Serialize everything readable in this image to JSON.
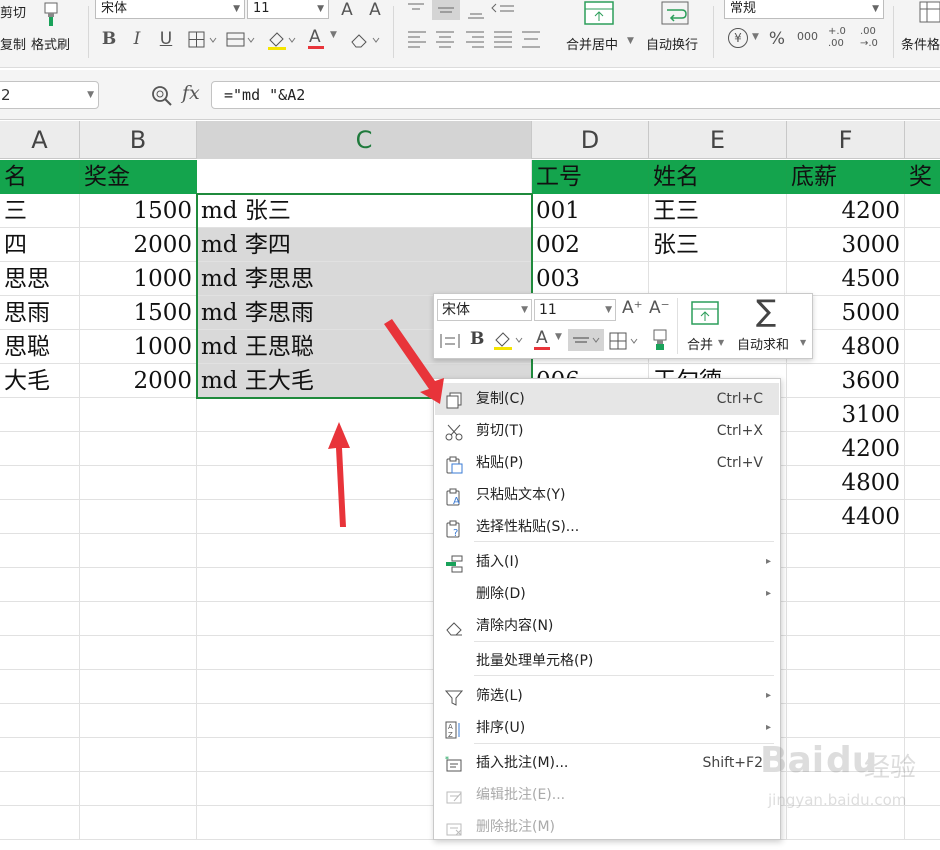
{
  "ribbon": {
    "cut_label": "剪切",
    "copy_label": "复制",
    "format_painter_label": "格式刷",
    "font_name": "宋体",
    "font_size": "11",
    "merge_center_label": "合并居中",
    "wrap_text_label": "自动换行",
    "number_format": "常规",
    "conditional_label": "条件格",
    "bold_glyph": "B",
    "italic_glyph": "I",
    "underline_glyph": "U",
    "font_color_glyph": "A",
    "currency_glyph": "¥",
    "percent_glyph": "%",
    "thousands_glyph": "000",
    "inc_decimal_glyph": "+.0 .00",
    "dec_decimal_glyph": ".00 →.0"
  },
  "formula_bar": {
    "name_box": "2",
    "fx_label": "fx",
    "formula": "=\"md \"&A2"
  },
  "columns": [
    "A",
    "B",
    "C",
    "D",
    "E",
    "F"
  ],
  "header_row": {
    "a": "名",
    "b": "奖金",
    "c": "",
    "d": "工号",
    "e": "姓名",
    "f": "底薪",
    "g": "奖"
  },
  "rows": [
    {
      "a": "三",
      "b": "1500",
      "c": "md 张三",
      "d": "001",
      "e": "王三",
      "f": "4200"
    },
    {
      "a": "四",
      "b": "2000",
      "c": "md 李四",
      "d": "002",
      "e": "张三",
      "f": "3000"
    },
    {
      "a": "思思",
      "b": "1000",
      "c": "md 李思思",
      "d": "003",
      "e": "",
      "f": "4500"
    },
    {
      "a": "思雨",
      "b": "1500",
      "c": "md 李思雨",
      "d": "",
      "e": "",
      "f": "5000"
    },
    {
      "a": "思聪",
      "b": "1000",
      "c": "md 王思聪",
      "d": "",
      "e": "",
      "f": "4800"
    },
    {
      "a": "大毛",
      "b": "2000",
      "c": "md 王大毛",
      "d": "006",
      "e": "王勾德",
      "f": "3600"
    },
    {
      "a": "",
      "b": "",
      "c": "",
      "d": "",
      "e": "",
      "f": "3100"
    },
    {
      "a": "",
      "b": "",
      "c": "",
      "d": "",
      "e": "",
      "f": "4200"
    },
    {
      "a": "",
      "b": "",
      "c": "",
      "d": "",
      "e": "",
      "f": "4800"
    },
    {
      "a": "",
      "b": "",
      "c": "",
      "d": "",
      "e": "",
      "f": "4400"
    }
  ],
  "mini_toolbar": {
    "font_name": "宋体",
    "font_size": "11",
    "merge_label": "合并",
    "autosum_label": "自动求和",
    "bold_glyph": "B",
    "font_color_glyph": "A",
    "grow_glyph": "A⁺",
    "shrink_glyph": "A⁻",
    "sigma_glyph": "∑"
  },
  "context_menu": [
    {
      "label": "复制(C)",
      "shortcut": "Ctrl+C",
      "icon": "copy-icon"
    },
    {
      "label": "剪切(T)",
      "shortcut": "Ctrl+X",
      "icon": "scissors-icon"
    },
    {
      "label": "粘贴(P)",
      "shortcut": "Ctrl+V",
      "icon": "paste-icon"
    },
    {
      "label": "只粘贴文本(Y)",
      "shortcut": "",
      "icon": "paste-text-icon"
    },
    {
      "label": "选择性粘贴(S)...",
      "shortcut": "",
      "icon": "paste-special-icon"
    },
    {
      "label": "插入(I)",
      "shortcut": "",
      "icon": "insert-icon"
    },
    {
      "label": "删除(D)",
      "shortcut": "",
      "icon": ""
    },
    {
      "label": "清除内容(N)",
      "shortcut": "",
      "icon": "eraser-icon"
    },
    {
      "label": "批量处理单元格(P)",
      "shortcut": "",
      "icon": ""
    },
    {
      "label": "筛选(L)",
      "shortcut": "",
      "icon": "filter-icon"
    },
    {
      "label": "排序(U)",
      "shortcut": "",
      "icon": "sort-icon"
    },
    {
      "label": "插入批注(M)...",
      "shortcut": "Shift+F2",
      "icon": "comment-add-icon"
    },
    {
      "label": "编辑批注(E)...",
      "shortcut": "",
      "icon": "comment-edit-icon"
    },
    {
      "label": "删除批注(M)",
      "shortcut": "",
      "icon": "comment-delete-icon"
    }
  ],
  "watermark": {
    "brand": "Bai",
    "brand2": "du",
    "jingyan": "经验",
    "url": "jingyan.baidu.com"
  },
  "colors": {
    "header_green": "#14a44d",
    "selection_green": "#1f8a3c",
    "annotation_red": "#e8343a",
    "ribbon_bg": "#f4f4f4"
  }
}
